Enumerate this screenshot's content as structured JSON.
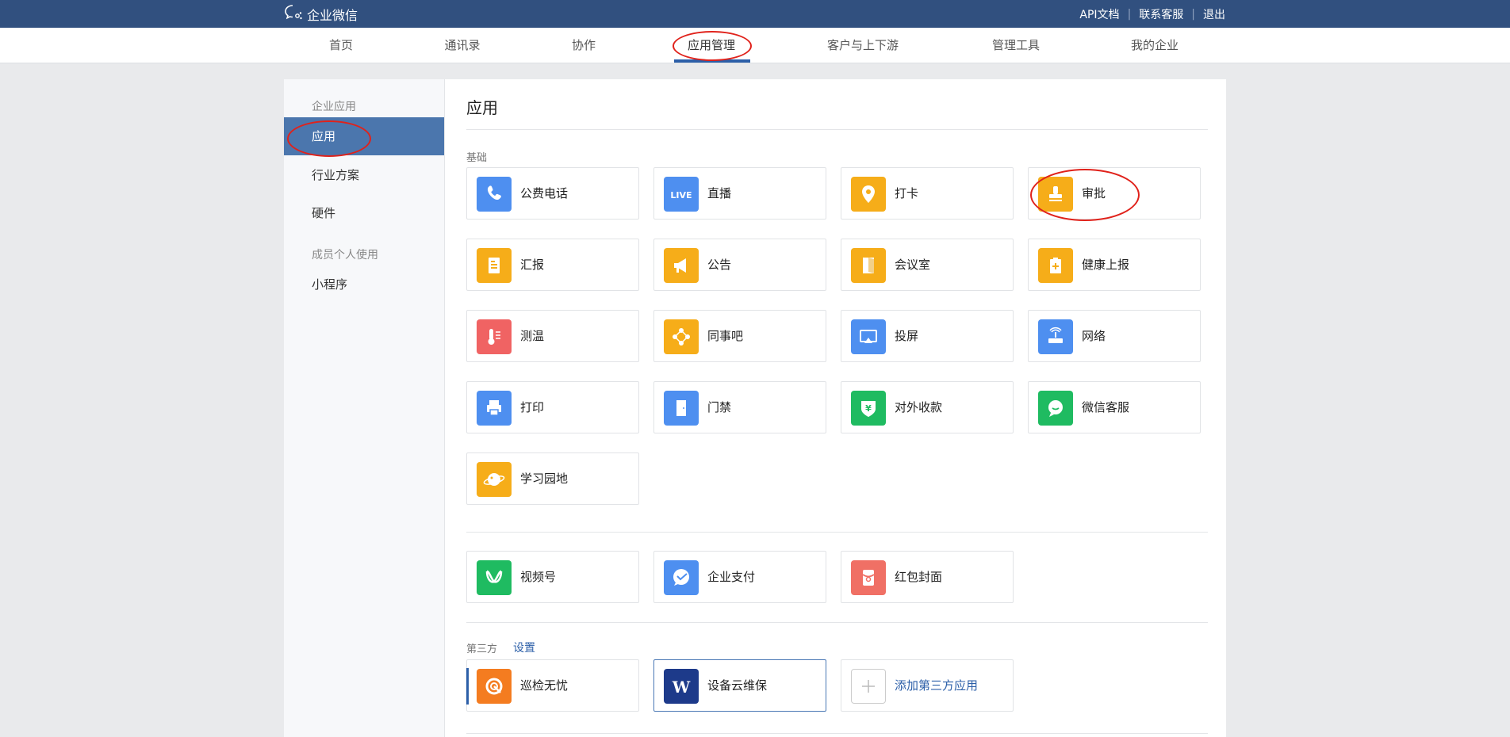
{
  "topbar": {
    "brand": "企业微信",
    "links": [
      "API文档",
      "联系客服",
      "退出"
    ]
  },
  "nav": {
    "items": [
      "首页",
      "通讯录",
      "协作",
      "应用管理",
      "客户与上下游",
      "管理工具",
      "我的企业"
    ],
    "active_index": 3
  },
  "sidebar": {
    "group_enterprise": "企业应用",
    "items_enterprise": [
      "应用",
      "行业方案",
      "硬件"
    ],
    "group_personal": "成员个人使用",
    "items_personal": [
      "小程序"
    ],
    "active_item": "应用"
  },
  "main": {
    "title": "应用",
    "basic_label": "基础",
    "basic_apps": [
      {
        "label": "公费电话",
        "icon": "phone-icon",
        "color": "#4e8ff0"
      },
      {
        "label": "直播",
        "icon": "live-icon",
        "color": "#4e8ff0"
      },
      {
        "label": "打卡",
        "icon": "location-pin-icon",
        "color": "#f6ad19"
      },
      {
        "label": "审批",
        "icon": "stamp-icon",
        "color": "#f6ad19"
      },
      {
        "label": "汇报",
        "icon": "report-icon",
        "color": "#f6ad19"
      },
      {
        "label": "公告",
        "icon": "megaphone-icon",
        "color": "#f6ad19"
      },
      {
        "label": "会议室",
        "icon": "door-icon",
        "color": "#f6ad19"
      },
      {
        "label": "健康上报",
        "icon": "health-clipboard-icon",
        "color": "#f6ad19"
      },
      {
        "label": "测温",
        "icon": "thermometer-icon",
        "color": "#f06363"
      },
      {
        "label": "同事吧",
        "icon": "network-nodes-icon",
        "color": "#f6ad19"
      },
      {
        "label": "投屏",
        "icon": "screen-cast-icon",
        "color": "#4e8ff0"
      },
      {
        "label": "网络",
        "icon": "router-icon",
        "color": "#4e8ff0"
      },
      {
        "label": "打印",
        "icon": "printer-icon",
        "color": "#4e8ff0"
      },
      {
        "label": "门禁",
        "icon": "door-access-icon",
        "color": "#4e8ff0"
      },
      {
        "label": "对外收款",
        "icon": "yuan-shield-icon",
        "color": "#1fbb61"
      },
      {
        "label": "微信客服",
        "icon": "chat-bubble-icon",
        "color": "#1fbb61"
      },
      {
        "label": "学习园地",
        "icon": "planet-icon",
        "color": "#f6ad19"
      }
    ],
    "wechat_apps": [
      {
        "label": "视频号",
        "icon": "channels-icon",
        "color": "#1fbb61"
      },
      {
        "label": "企业支付",
        "icon": "wechat-pay-icon",
        "color": "#4e8ff0"
      },
      {
        "label": "红包封面",
        "icon": "red-packet-icon",
        "color": "#f07065"
      }
    ],
    "third_party_label": "第三方",
    "third_party_settings": "设置",
    "third_party_apps": [
      {
        "label": "巡检无忧",
        "icon": "inspection-icon",
        "color": "#f47c20"
      },
      {
        "label": "设备云维保",
        "icon": "w-logo-icon",
        "color": "#1d3a8a"
      },
      {
        "label": "添加第三方应用",
        "icon": "plus-icon",
        "color": "#cccccc"
      }
    ]
  },
  "colors": {
    "topbar": "#31507f",
    "accent": "#2c5fa8",
    "sidebar_active": "#4b76ad",
    "annotation": "#e0221b"
  }
}
